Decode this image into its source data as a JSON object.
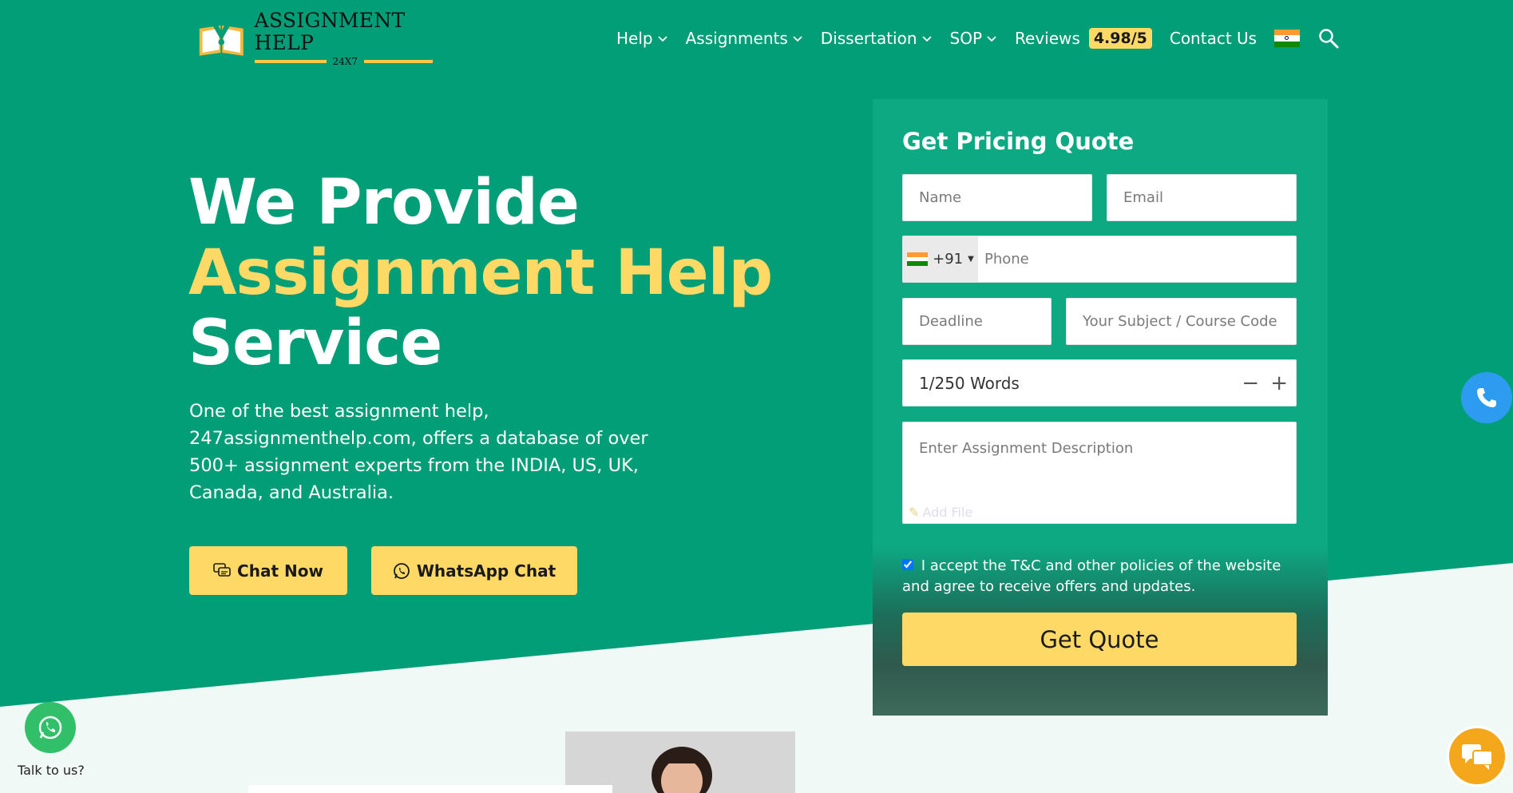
{
  "brand": {
    "title": "ASSIGNMENT HELP",
    "subtitle": "24X7",
    "accent": "#ffd966",
    "primary": "#019e77"
  },
  "nav": {
    "items": [
      {
        "label": "Help",
        "icon": "chevron-down-icon"
      },
      {
        "label": "Assignments",
        "icon": "chevron-down-icon"
      },
      {
        "label": "Dissertation",
        "icon": "chevron-down-icon"
      },
      {
        "label": "SOP",
        "icon": "chevron-down-icon"
      }
    ],
    "reviews_label": "Reviews",
    "reviews_rating": "4.98/5",
    "contact_label": "Contact Us",
    "country_icon": "india-flag-icon",
    "search_icon": "search-icon"
  },
  "hero": {
    "line1": "We Provide",
    "line2": "Assignment Help",
    "line3": "Service",
    "description": "One of the best assignment help, 247assignmenthelp.com, offers a database of over 500+ assignment experts from the INDIA, US, UK, Canada, and Australia.",
    "chat_label": "Chat Now",
    "whatsapp_label": "WhatsApp Chat"
  },
  "form": {
    "title": "Get Pricing Quote",
    "name_placeholder": "Name",
    "email_placeholder": "Email",
    "phone_code": "+91",
    "phone_placeholder": "Phone",
    "deadline_placeholder": "Deadline",
    "subject_placeholder": "Your Subject / Course Code",
    "words_value": "1/250 Words",
    "minus": "−",
    "plus": "+",
    "description_placeholder": "Enter Assignment Description",
    "add_file": "Add File",
    "terms": "I accept the T&C and other policies of the website and agree to receive offers and updates.",
    "terms_checked": true,
    "submit_label": "Get Quote"
  },
  "floating": {
    "talk_label": "Talk to us?"
  }
}
